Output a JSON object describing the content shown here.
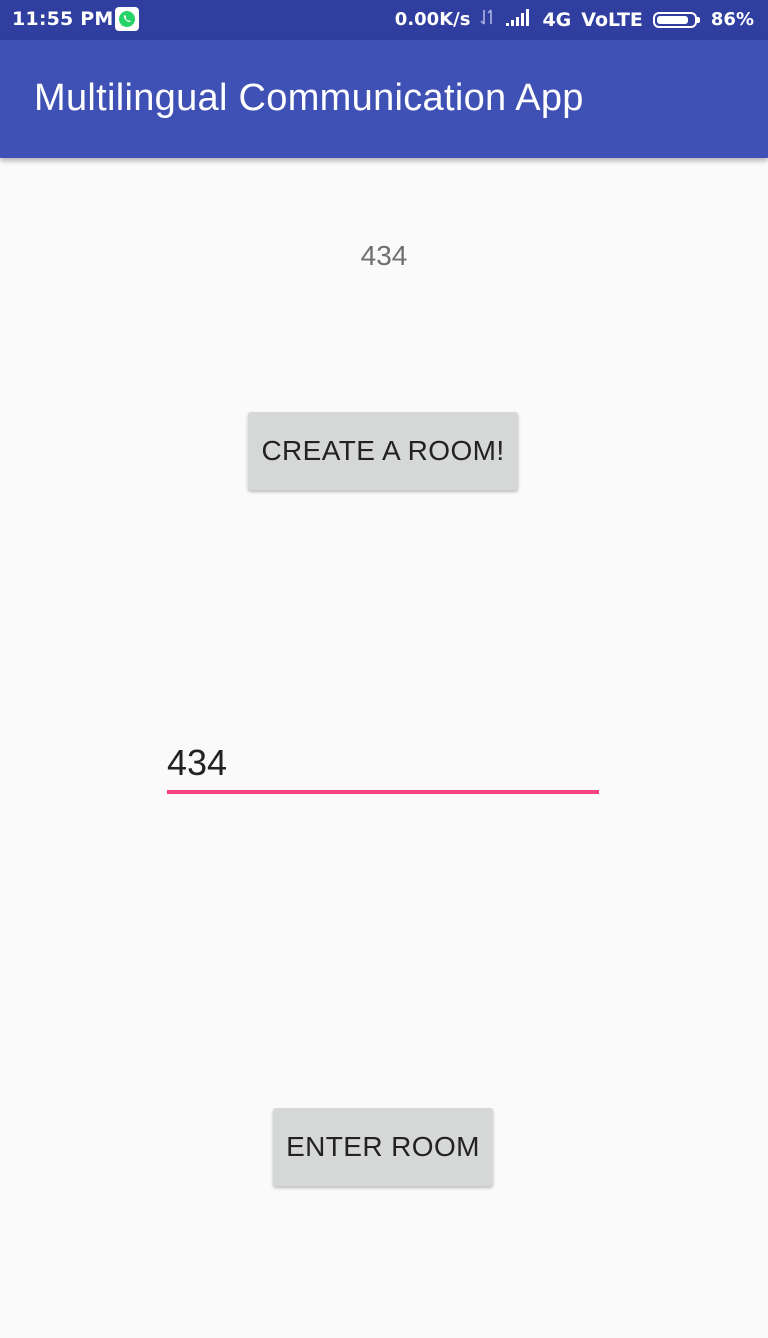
{
  "status_bar": {
    "time": "11:55 PM",
    "network_speed": "0.00K/s",
    "network_type": "4G",
    "volte": "VoLTE",
    "battery_percent": "86%",
    "battery_level": 0.86,
    "notification_icons": [
      "whatsapp-icon"
    ]
  },
  "app_bar": {
    "title": "Multilingual Communication App",
    "color": "#3f51b5"
  },
  "main": {
    "room_code_text": "434",
    "create_button_label": "CREATE A ROOM!",
    "room_input_value": "434",
    "enter_button_label": "ENTER ROOM"
  },
  "colors": {
    "status_bar": "#303f9f",
    "primary": "#3f51b5",
    "accent": "#ff4081",
    "button": "#d6d7d7",
    "background": "#fafafa"
  }
}
